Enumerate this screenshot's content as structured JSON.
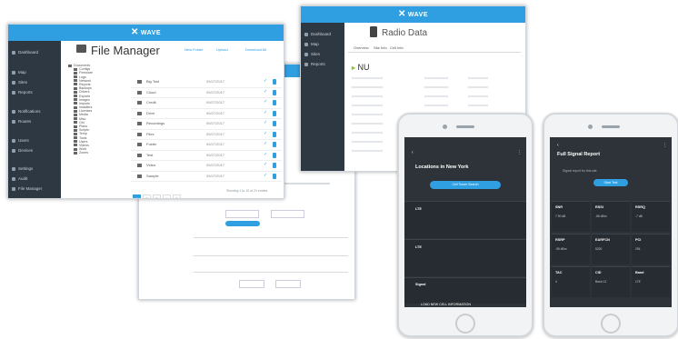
{
  "brand": {
    "name": "WAVE",
    "mark": "✕"
  },
  "file_manager": {
    "title": "File Manager",
    "sidebar": [
      "Dashboard",
      "Map",
      "Sites",
      "Reports",
      "Notifications",
      "Routes",
      "Users",
      "Devices",
      "Settings",
      "Audit",
      "File Manager"
    ],
    "actions": [
      "New Folder",
      "Upload",
      "Download All"
    ],
    "tree": [
      "Documents",
      "Configs",
      "Firmware",
      "Logs",
      "Network",
      "Reports",
      "Backups",
      "Drivers",
      "Exports",
      "Images",
      "Imports",
      "Installers",
      "Licenses",
      "Media",
      "Misc",
      "Old",
      "Plans",
      "Scripts",
      "Temp",
      "Tools",
      "Users",
      "Videos",
      "Work",
      "Zones"
    ],
    "rows": [
      {
        "name": "Big Test",
        "date": "09/27/2017"
      },
      {
        "name": "Cloud",
        "date": "09/27/2017"
      },
      {
        "name": "Credit",
        "date": "09/27/2017"
      },
      {
        "name": "Drive",
        "date": "09/27/2017"
      },
      {
        "name": "Recordings",
        "date": "09/27/2017"
      },
      {
        "name": "Files",
        "date": "09/27/2017"
      },
      {
        "name": "Folder",
        "date": "09/27/2017"
      },
      {
        "name": "Test",
        "date": "09/27/2017"
      },
      {
        "name": "Video",
        "date": "09/27/2017"
      },
      {
        "name": "Sample",
        "date": "09/27/2017"
      }
    ],
    "pages": [
      "1",
      "2",
      "3",
      "4",
      "5"
    ],
    "page_info": "Showing 1 to 10 of 24 entries"
  },
  "radio": {
    "title": "Radio Data",
    "tabs": [
      "Overview",
      "Site Info",
      "Cell Info"
    ],
    "sidebar": [
      "Dashboard",
      "Map",
      "Sites",
      "Reports"
    ],
    "carrier": "NU"
  },
  "phone1": {
    "title": "Locations in New York",
    "button": "Cell Tower Search",
    "cards": [
      "LTE",
      "LTE",
      "Signal"
    ],
    "footer": "LOAD NEW CELL INFORMATION"
  },
  "phone2": {
    "title": "Full Signal Report",
    "desc": "Signal report for this site",
    "button": "Start Test",
    "heads": [
      "SNR",
      "RSSI",
      "RSRQ",
      "RSRP",
      "EARFCN",
      "PCI",
      "TAC",
      "CID",
      "Band"
    ],
    "values": [
      "7.90 dB",
      "-65 dBm",
      "-7 dB",
      "-95 dBm",
      "5230",
      "294",
      "4",
      "Band 12",
      "LTE"
    ]
  }
}
